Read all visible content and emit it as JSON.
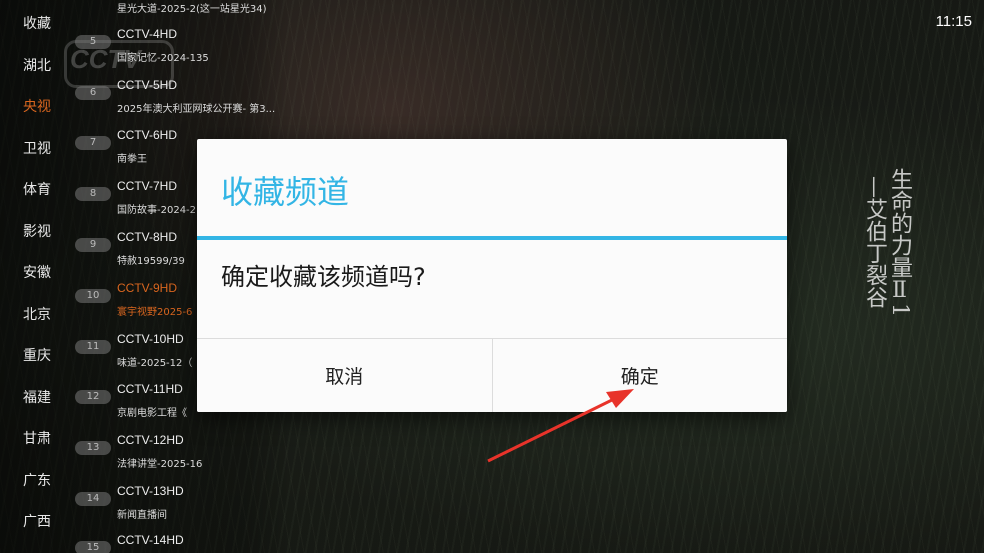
{
  "clock": "11:15",
  "logo": {
    "text": "CCTV",
    "sub": "纪"
  },
  "categories": [
    {
      "label": "收藏"
    },
    {
      "label": "湖北"
    },
    {
      "label": "央视"
    },
    {
      "label": "卫视"
    },
    {
      "label": "体育"
    },
    {
      "label": "影视"
    },
    {
      "label": "安徽"
    },
    {
      "label": "北京"
    },
    {
      "label": "重庆"
    },
    {
      "label": "福建"
    },
    {
      "label": "甘肃"
    },
    {
      "label": "广东"
    },
    {
      "label": "广西"
    }
  ],
  "active_category": "央视",
  "channels": [
    {
      "num": "",
      "name": "",
      "program": "星光大道-2025-2(这一站星光34)"
    },
    {
      "num": "5",
      "name": "CCTV-4HD",
      "program": "国家记忆-2024-135"
    },
    {
      "num": "6",
      "name": "CCTV-5HD",
      "program": "2025年澳大利亚网球公开赛- 第3..."
    },
    {
      "num": "7",
      "name": "CCTV-6HD",
      "program": "南拳王"
    },
    {
      "num": "8",
      "name": "CCTV-7HD",
      "program": "国防故事-2024-2"
    },
    {
      "num": "9",
      "name": "CCTV-8HD",
      "program": "特赦19599/39"
    },
    {
      "num": "10",
      "name": "CCTV-9HD",
      "program": "寰宇视野2025-6"
    },
    {
      "num": "11",
      "name": "CCTV-10HD",
      "program": "味道-2025-12（"
    },
    {
      "num": "12",
      "name": "CCTV-11HD",
      "program": "京剧电影工程《"
    },
    {
      "num": "13",
      "name": "CCTV-12HD",
      "program": "法律讲堂-2025-16"
    },
    {
      "num": "14",
      "name": "CCTV-13HD",
      "program": "新闻直播间"
    },
    {
      "num": "15",
      "name": "CCTV-14HD",
      "program": ""
    }
  ],
  "active_channel": "CCTV-9HD",
  "poem": {
    "col1": "生命的力量Ⅱ1",
    "col2": "—艾伯丁裂谷"
  },
  "dialog": {
    "title": "收藏频道",
    "message": "确定收藏该频道吗?",
    "cancel_label": "取消",
    "confirm_label": "确定"
  },
  "colors": {
    "accent": "#33b5e5",
    "active": "#d9661f",
    "arrow": "#e8332a"
  }
}
